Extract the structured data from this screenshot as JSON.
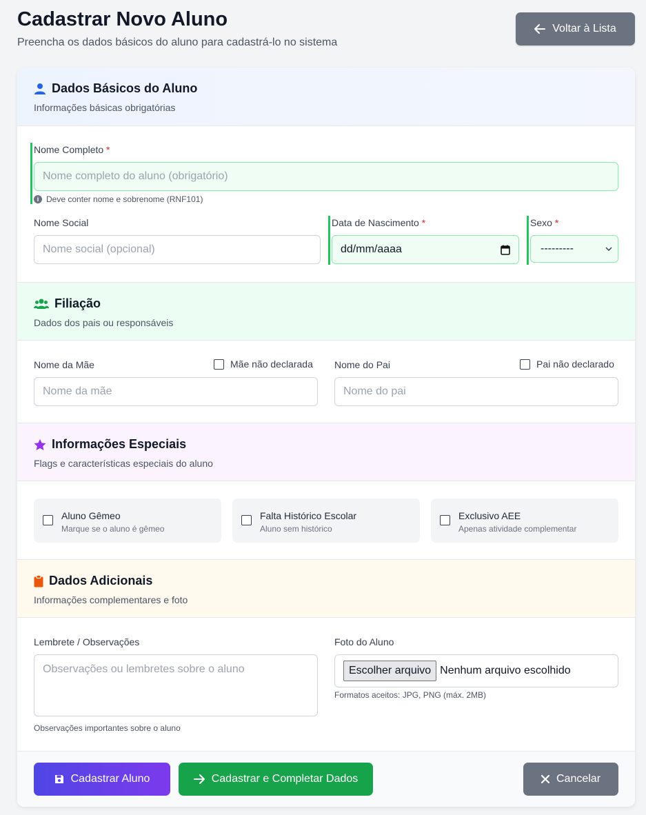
{
  "header": {
    "title": "Cadastrar Novo Aluno",
    "subtitle": "Preencha os dados básicos do aluno para cadastrá-lo no sistema",
    "back_label": "Voltar à Lista"
  },
  "basic": {
    "title": "Dados Básicos do Aluno",
    "desc": "Informações básicas obrigatórias",
    "full_name_label": "Nome Completo",
    "full_name_placeholder": "Nome completo do aluno (obrigatório)",
    "full_name_hint": "Deve conter nome e sobrenome (RNF101)",
    "social_name_label": "Nome Social",
    "social_name_placeholder": "Nome social (opcional)",
    "birth_label": "Data de Nascimento",
    "birth_value": "dd/mm/aaaa",
    "sex_label": "Sexo",
    "sex_value": "---------",
    "required_mark": "*"
  },
  "filiation": {
    "title": "Filiação",
    "desc": "Dados dos pais ou responsáveis",
    "mother_label": "Nome da Mãe",
    "mother_undeclared": "Mãe não declarada",
    "mother_placeholder": "Nome da mãe",
    "father_label": "Nome do Pai",
    "father_undeclared": "Pai não declarado",
    "father_placeholder": "Nome do pai"
  },
  "special": {
    "title": "Informações Especiais",
    "desc": "Flags e características especiais do aluno",
    "flags": [
      {
        "title": "Aluno Gêmeo",
        "subtitle": "Marque se o aluno é gêmeo"
      },
      {
        "title": "Falta Histórico Escolar",
        "subtitle": "Aluno sem histórico"
      },
      {
        "title": "Exclusivo AEE",
        "subtitle": "Apenas atividade complementar"
      }
    ]
  },
  "additional": {
    "title": "Dados Adicionais",
    "desc": "Informações complementares e foto",
    "notes_label": "Lembrete / Observações",
    "notes_placeholder": "Observações ou lembretes sobre o aluno",
    "notes_hint": "Observações importantes sobre o aluno",
    "photo_label": "Foto do Aluno",
    "photo_button": "Escolher arquivo",
    "photo_status": "Nenhum arquivo escolhido",
    "photo_hint": "Formatos aceitos: JPG, PNG (máx. 2MB)"
  },
  "footer": {
    "submit_label": "Cadastrar Aluno",
    "submit_complete_label": "Cadastrar e Completar Dados",
    "cancel_label": "Cancelar"
  },
  "colors": {
    "basic_bg": "#eef4fe",
    "filiation_bg": "#ecfdf3",
    "special_bg": "#fbf3fd",
    "additional_bg": "#fffaed",
    "required": "#dc2626",
    "valid_bar": "#22c55e"
  },
  "icons": {
    "back": "arrow-left-icon",
    "basic": "user-icon",
    "filiation": "users-icon",
    "special": "star-icon",
    "additional": "clipboard-icon",
    "info": "info-icon",
    "date": "calendar-icon",
    "select": "chevron-down-icon",
    "submit": "save-icon",
    "submit_complete": "arrow-right-icon",
    "cancel": "close-icon"
  }
}
